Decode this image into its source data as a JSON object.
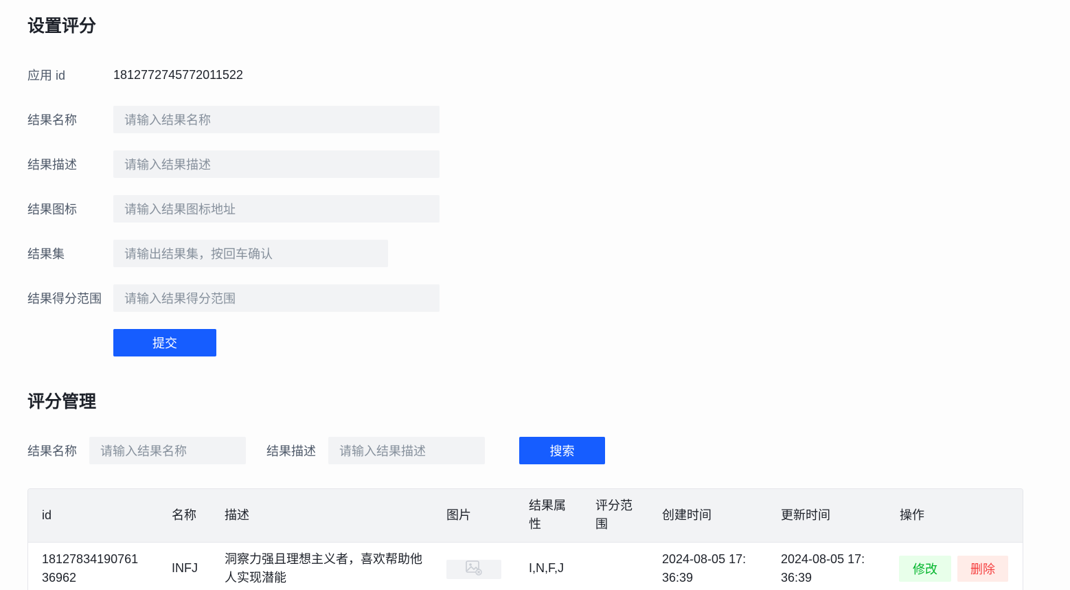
{
  "settings": {
    "title": "设置评分",
    "app_id_label": "应用 id",
    "app_id_value": "1812772745772011522",
    "fields": [
      {
        "label": "结果名称",
        "placeholder": "请输入结果名称"
      },
      {
        "label": "结果描述",
        "placeholder": "请输入结果描述"
      },
      {
        "label": "结果图标",
        "placeholder": "请输入结果图标地址"
      },
      {
        "label": "结果集",
        "placeholder": "请输出结果集，按回车确认"
      },
      {
        "label": "结果得分范围",
        "placeholder": "请输入结果得分范围"
      }
    ],
    "submit_label": "提交"
  },
  "manage": {
    "title": "评分管理",
    "search": {
      "name_label": "结果名称",
      "name_placeholder": "请输入结果名称",
      "desc_label": "结果描述",
      "desc_placeholder": "请输入结果描述",
      "button_label": "搜索"
    },
    "table": {
      "headers": {
        "id": "id",
        "name": "名称",
        "desc": "描述",
        "image": "图片",
        "prop_line1": "结果属",
        "prop_line2": "性",
        "range_line1": "评分范",
        "range_line2": "围",
        "created": "创建时间",
        "updated": "更新时间",
        "ops": "操作"
      },
      "rows": [
        {
          "id_line1": "18127834190761",
          "id_line2": "36962",
          "name": "INFJ",
          "desc_line1": "洞察力强且理想主义者，喜欢帮助他",
          "desc_line2": "人实现潜能",
          "props": "I,N,F,J",
          "range": "",
          "created_line1": "2024-08-05 17:",
          "created_line2": "36:39",
          "updated_line1": "2024-08-05 17:",
          "updated_line2": "36:39",
          "edit_label": "修改",
          "delete_label": "删除"
        }
      ]
    }
  }
}
